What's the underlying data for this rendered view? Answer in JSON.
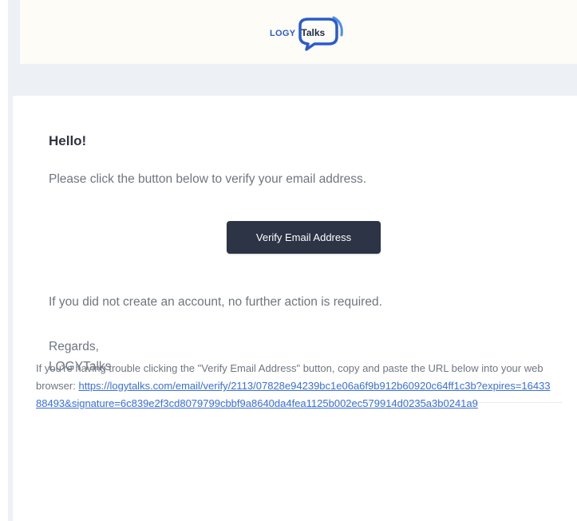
{
  "header": {
    "logo_part1": "LOGY",
    "logo_part2": "Talks"
  },
  "email": {
    "greeting": "Hello!",
    "intro": "Please click the button below to verify your email address.",
    "button_label": "Verify Email Address",
    "no_action": "If you did not create an account, no further action is required.",
    "regards": "Regards,",
    "signature": "LOGYTalks",
    "trouble_text": "If you're having trouble clicking the \"Verify Email Address\" button, copy and paste the URL below into your web browser: ",
    "verify_url": "https://logytalks.com/email/verify/2113/07828e94239bc1e06a6f9b912b60920c64ff1c3b?expires=1643388493&signature=6c839e2f3cd8079799cbbf9a8640da4fea1125b002ec579914d0235a3b0241a9"
  },
  "colors": {
    "page_bg": "#edf0f5",
    "button_bg": "#2c3445",
    "link": "#3a6fd8",
    "logo_blue": "#2a5bcc"
  }
}
